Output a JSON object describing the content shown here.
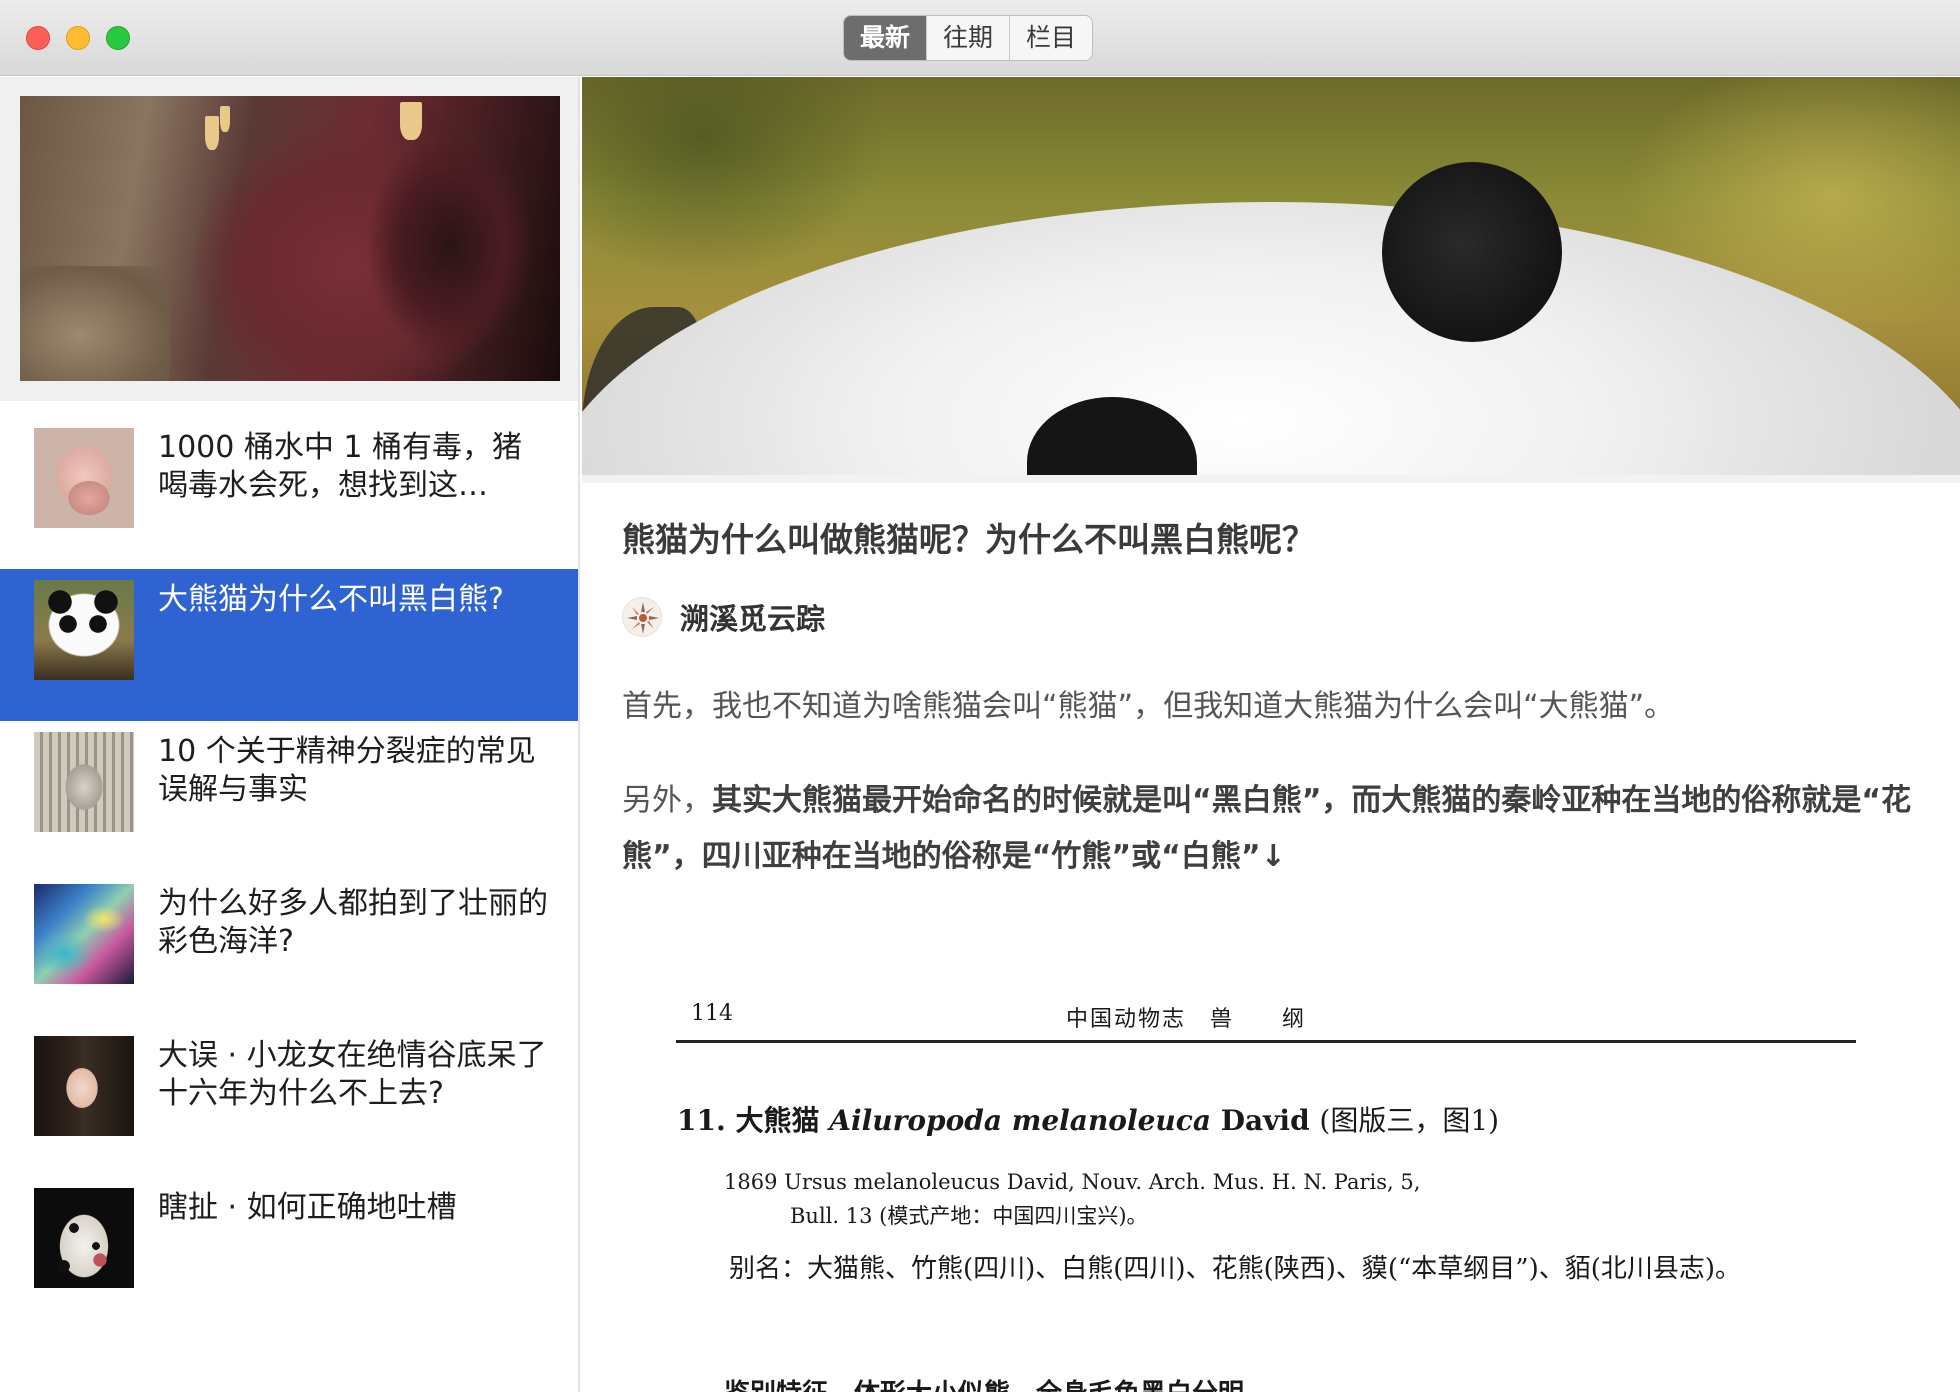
{
  "toolbar": {
    "segments": [
      "最新",
      "往期",
      "栏目"
    ],
    "active_segment": "最新"
  },
  "sidebar": {
    "items": [
      {
        "title": "1000 桶水中 1 桶有毒，猪喝毒水会死，想找到这…",
        "thumb": "pig-photo"
      },
      {
        "title": "大熊猫为什么不叫黑白熊?",
        "thumb": "panda-photo",
        "selected": true
      },
      {
        "title": "10 个关于精神分裂症的常见误解与事实",
        "thumb": "carved-face-photo"
      },
      {
        "title": "为什么好多人都拍到了壮丽的彩色海洋?",
        "thumb": "colorful-ocean-photo"
      },
      {
        "title": "大误 · 小龙女在绝情谷底呆了十六年为什么不上去?",
        "thumb": "actress-photo"
      },
      {
        "title": "瞎扯 · 如何正确地吐槽",
        "thumb": "dalmatian-photo"
      }
    ]
  },
  "article": {
    "title": "熊猫为什么叫做熊猫呢？为什么不叫黑白熊呢？",
    "author": "溯溪觅云踪",
    "p1": "首先，我也不知道为啥熊猫会叫“熊猫”，但我知道大熊猫为什么会叫“大熊猫”。",
    "p2_lead": "另外，",
    "p2_bold": "其实大熊猫最开始命名的时候就是叫“黑白熊”，而大熊猫的秦岭亚种在当地的俗称就是“花熊”，四川亚种在当地的俗称是“竹熊”或“白熊”↓"
  },
  "scan": {
    "page_number": "114",
    "running_head": "中国动物志　兽　　纲",
    "heading_cn": "11. 大熊猫",
    "heading_latin": "Ailuropoda melanoleuca",
    "heading_author": "David",
    "heading_note": "(图版三，图1)",
    "synonym_line1": "1869  Ursus melanoleucus David, Nouv. Arch. Mus. H. N. Paris, 5,",
    "synonym_line2": "Bull. 13 (模式产地：中国四川宝兴)。",
    "alias": "别名：大猫熊、竹熊(四川)、白熊(四川)、花熊(陕西)、貘(“本草纲目”)、貊(北川县志)。",
    "cut_text": "鉴别特征　体形大小似熊，全身毛色黑白分明"
  },
  "colors": {
    "selection": "#2f63d2",
    "segment_active": "#6d6d6d"
  }
}
